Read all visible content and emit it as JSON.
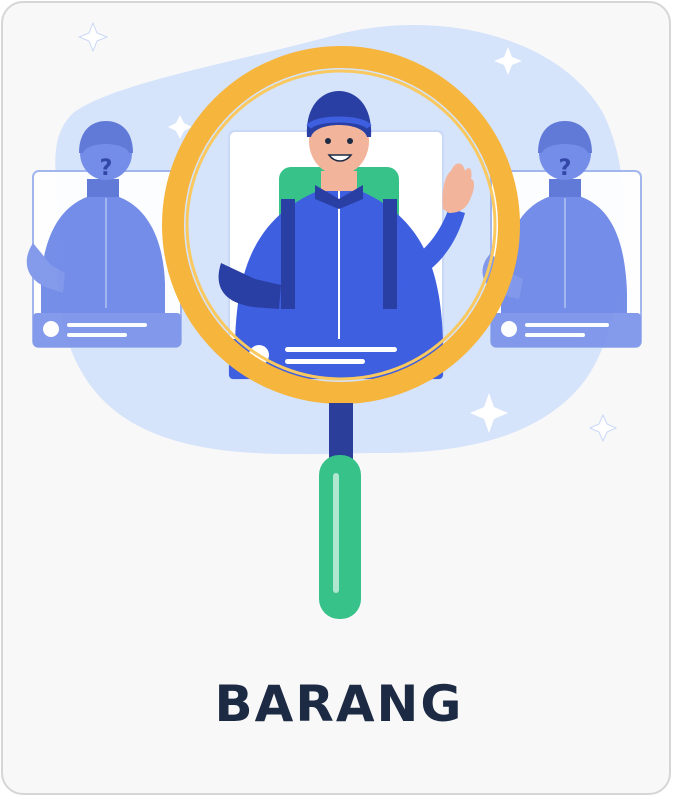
{
  "card": {
    "label": "BARANG"
  },
  "colors": {
    "blob": "#d5e3fb",
    "person_jacket": "#3d5fe0",
    "person_dark": "#2a3fa3",
    "faded_person": "#6f89e8",
    "magnifier_ring": "#f6b53d",
    "handle": "#37c28a",
    "neck": "#2a3e9a",
    "text": "#1d2a44"
  },
  "icons": [
    "sparkle-icon",
    "avatar-icon",
    "question-mark-icon",
    "magnifying-glass-icon"
  ],
  "silhouette_mark": "?"
}
